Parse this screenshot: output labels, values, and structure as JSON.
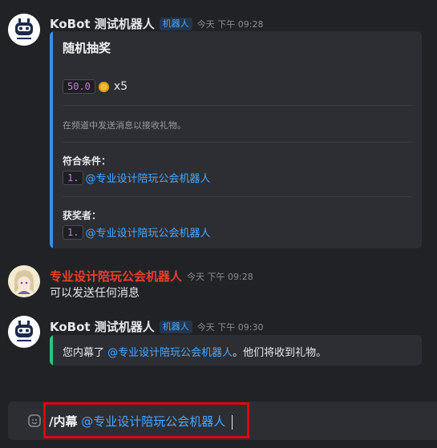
{
  "messages": {
    "m1": {
      "author": "KoBot 测试机器人",
      "badge": "机器人",
      "time": "今天 下午 09:28",
      "card": {
        "title": "随机抽奖",
        "amount": "50.0",
        "coin_icon": "coin-icon",
        "count": "x5",
        "description": "在频道中发送消息以接收礼物。",
        "condition_label": "符合条件：",
        "condition_index": "1.",
        "condition_mention": "@专业设计陪玩公会机器人",
        "winner_label": "获奖者：",
        "winner_index": "1.",
        "winner_mention": "@专业设计陪玩公会机器人"
      }
    },
    "m2": {
      "author": "专业设计陪玩公会机器人",
      "time": "今天 下午 09:28",
      "text": "可以发送任何消息"
    },
    "m3": {
      "author": "KoBot 测试机器人",
      "badge": "机器人",
      "time": "今天 下午 09:30",
      "card": {
        "prefix": "您内幕了 ",
        "mention": "@专业设计陪玩公会机器人",
        "suffix": "。他们将收到礼物。"
      }
    }
  },
  "composer": {
    "command": "/内幕",
    "mention": "@专业设计陪玩公会机器人",
    "emoji_icon": "emoji-icon"
  },
  "colors": {
    "accent_blue": "#4aa8ff",
    "card_bar_blue": "#3a8ef0",
    "card_bar_green": "#2ec27e",
    "author_red": "#e8402f",
    "highlight_red": "#e3000f"
  }
}
